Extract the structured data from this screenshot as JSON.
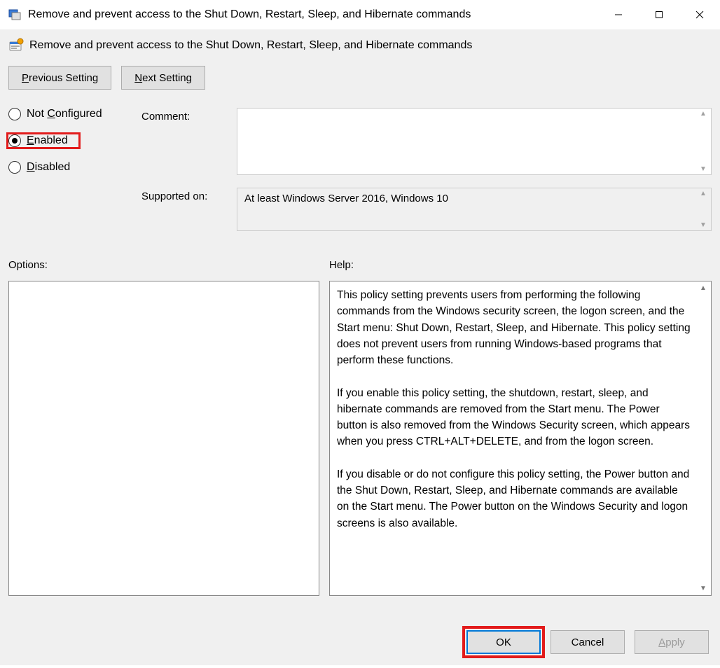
{
  "window": {
    "title": "Remove and prevent access to the Shut Down, Restart, Sleep, and Hibernate commands"
  },
  "heading": "Remove and prevent access to the Shut Down, Restart, Sleep, and Hibernate commands",
  "nav": {
    "previous": "Previous Setting",
    "next": "Next Setting"
  },
  "radios": {
    "not_configured": "Not Configured",
    "enabled": "Enabled",
    "disabled": "Disabled",
    "selected": "enabled"
  },
  "fields": {
    "comment_label": "Comment:",
    "comment_value": "",
    "supported_label": "Supported on:",
    "supported_value": "At least Windows Server 2016, Windows 10"
  },
  "sections": {
    "options_label": "Options:",
    "help_label": "Help:"
  },
  "help_text": "This policy setting prevents users from performing the following commands from the Windows security screen, the logon screen, and the Start menu: Shut Down, Restart, Sleep, and Hibernate. This policy setting does not prevent users from running Windows-based programs that perform these functions.\n\nIf you enable this policy setting, the shutdown, restart, sleep, and hibernate commands are removed from the Start menu. The Power button is also removed from the Windows Security screen, which appears when you press CTRL+ALT+DELETE, and from the logon screen.\n\nIf you disable or do not configure this policy setting, the Power button and the Shut Down, Restart, Sleep, and Hibernate commands are available on the Start menu. The Power button on the Windows Security and logon screens is also available.",
  "footer": {
    "ok": "OK",
    "cancel": "Cancel",
    "apply": "Apply"
  }
}
